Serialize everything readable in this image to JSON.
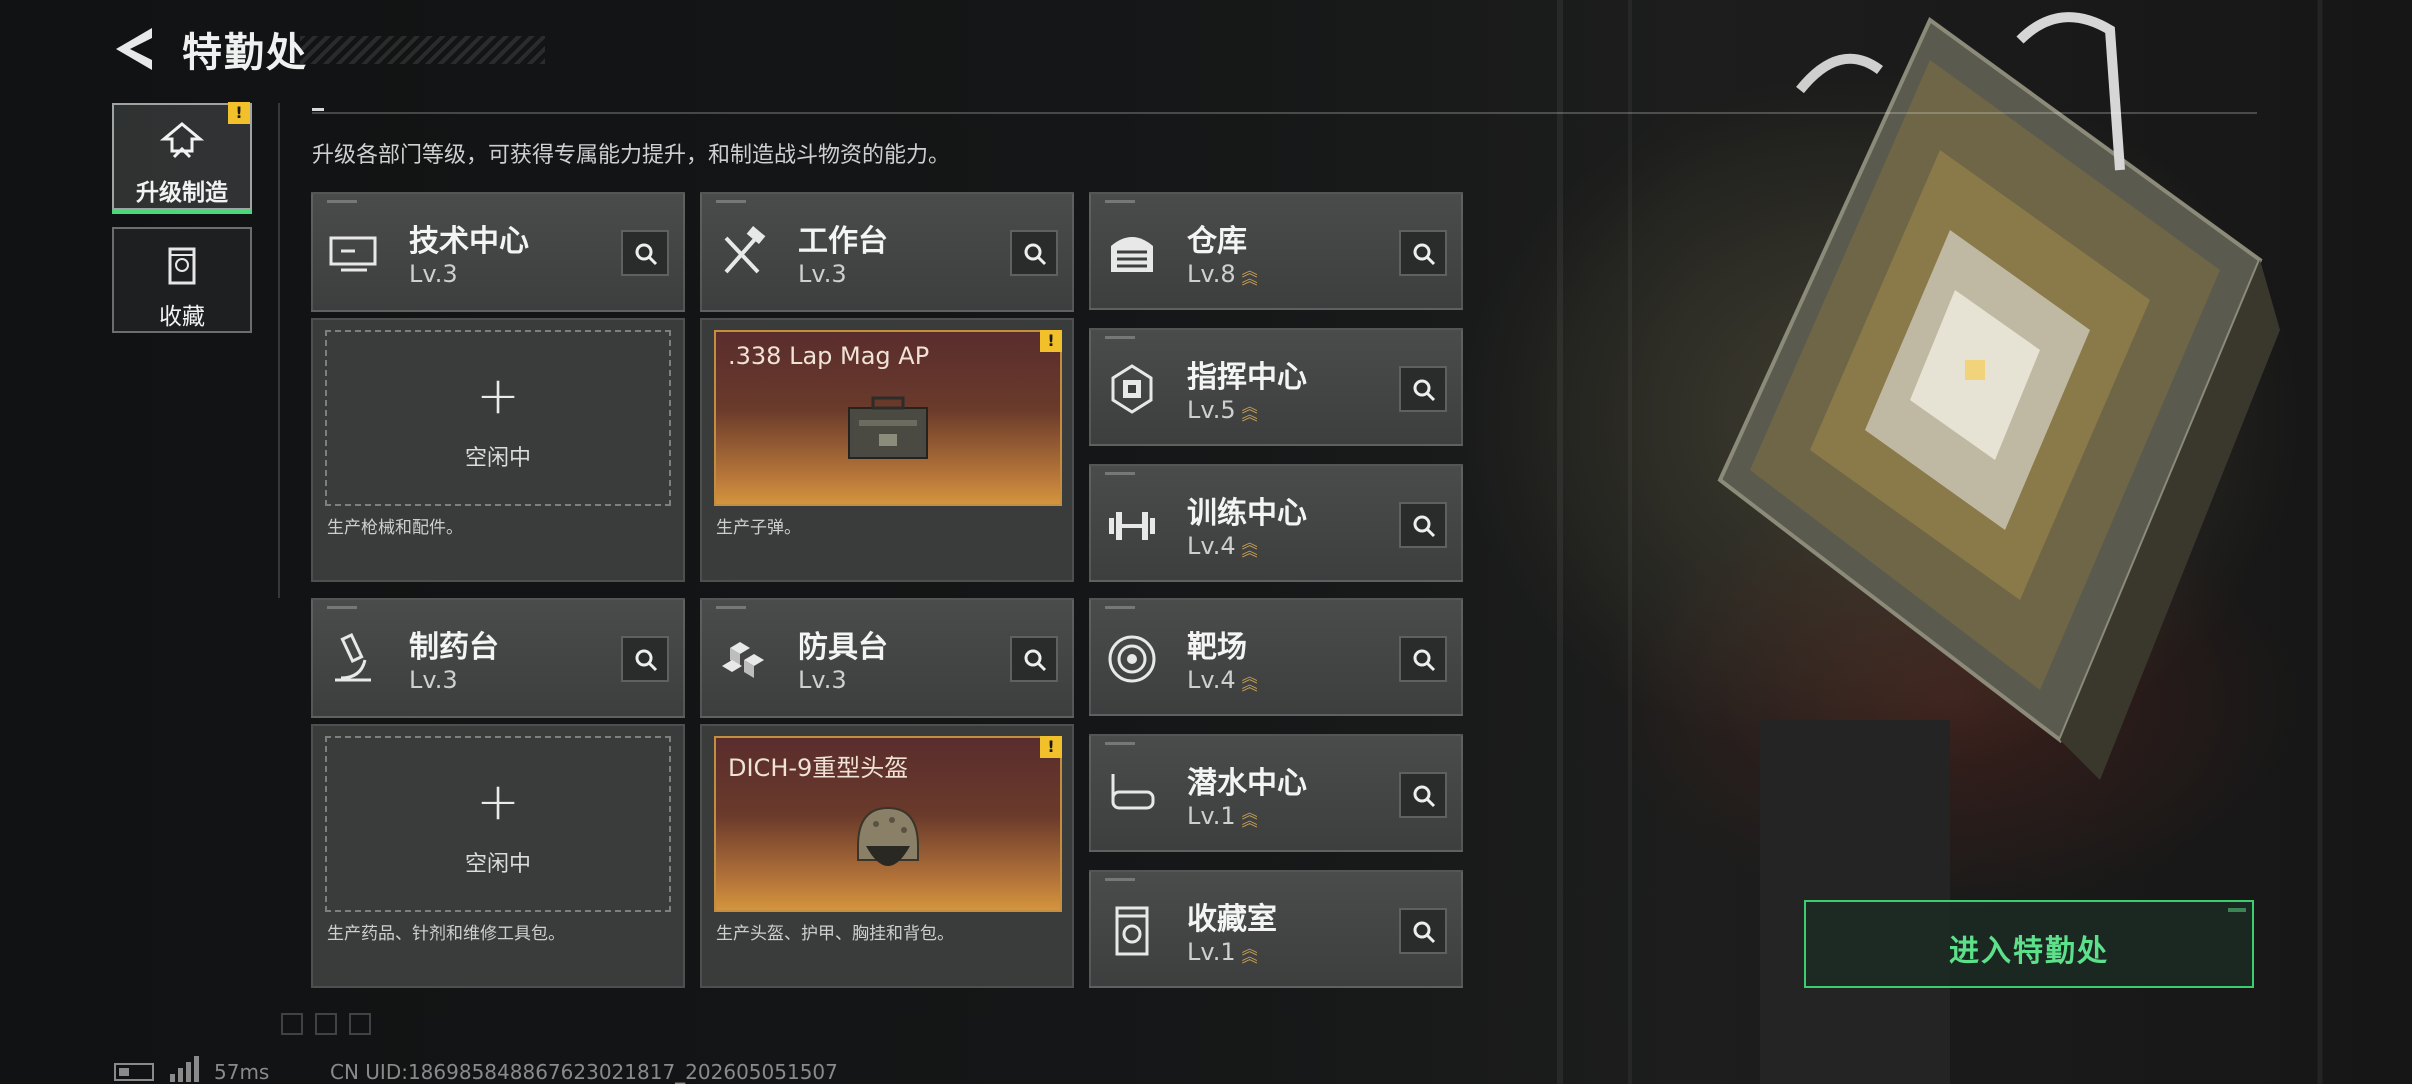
{
  "header": {
    "title": "特勤处",
    "subtitle": "升级各部门等级，可获得专属能力提升，和制造战斗物资的能力。"
  },
  "sidebar": {
    "tabs": [
      {
        "label": "升级制造",
        "active": true,
        "icon": "upgrade-icon",
        "badge": "!"
      },
      {
        "label": "收藏",
        "active": false,
        "icon": "collection-icon"
      }
    ]
  },
  "colors": {
    "accent_green": "#49d97a",
    "badge_yellow": "#f2c02a",
    "level_chevron": "#c8a154"
  },
  "departments": {
    "tech_center": {
      "name": "技术中心",
      "level": "Lv.3",
      "icon": "tech-center-icon",
      "slot_state": "空闲中",
      "desc": "生产枪械和配件。"
    },
    "workbench": {
      "name": "工作台",
      "level": "Lv.3",
      "icon": "hammer-wrench-icon",
      "product": ".338 Lap Mag AP",
      "product_icon": "ammo-box-icon",
      "badge": "!",
      "desc": "生产子弹。"
    },
    "pharmacy": {
      "name": "制药台",
      "level": "Lv.3",
      "icon": "microscope-icon",
      "slot_state": "空闲中",
      "desc": "生产药品、针剂和维修工具包。"
    },
    "armor_bench": {
      "name": "防具台",
      "level": "Lv.3",
      "icon": "armor-blocks-icon",
      "product": "DICH-9重型头盔",
      "product_icon": "helmet-icon",
      "badge": "!",
      "desc": "生产头盔、护甲、胸挂和背包。"
    },
    "warehouse": {
      "name": "仓库",
      "level": "Lv.8",
      "icon": "warehouse-icon"
    },
    "command": {
      "name": "指挥中心",
      "level": "Lv.5",
      "icon": "command-chip-icon"
    },
    "training": {
      "name": "训练中心",
      "level": "Lv.4",
      "icon": "dumbbell-icon"
    },
    "range": {
      "name": "靶场",
      "level": "Lv.4",
      "icon": "target-icon"
    },
    "diving": {
      "name": "潜水中心",
      "level": "Lv.1",
      "icon": "diving-mask-icon"
    },
    "collection_room": {
      "name": "收藏室",
      "level": "Lv.1",
      "icon": "collection-icon"
    }
  },
  "actions": {
    "enter_label": "进入特勤处"
  },
  "status_bar": {
    "ping": "57ms",
    "uid": "CN UID:18698584886762302181​7_202605051507"
  }
}
